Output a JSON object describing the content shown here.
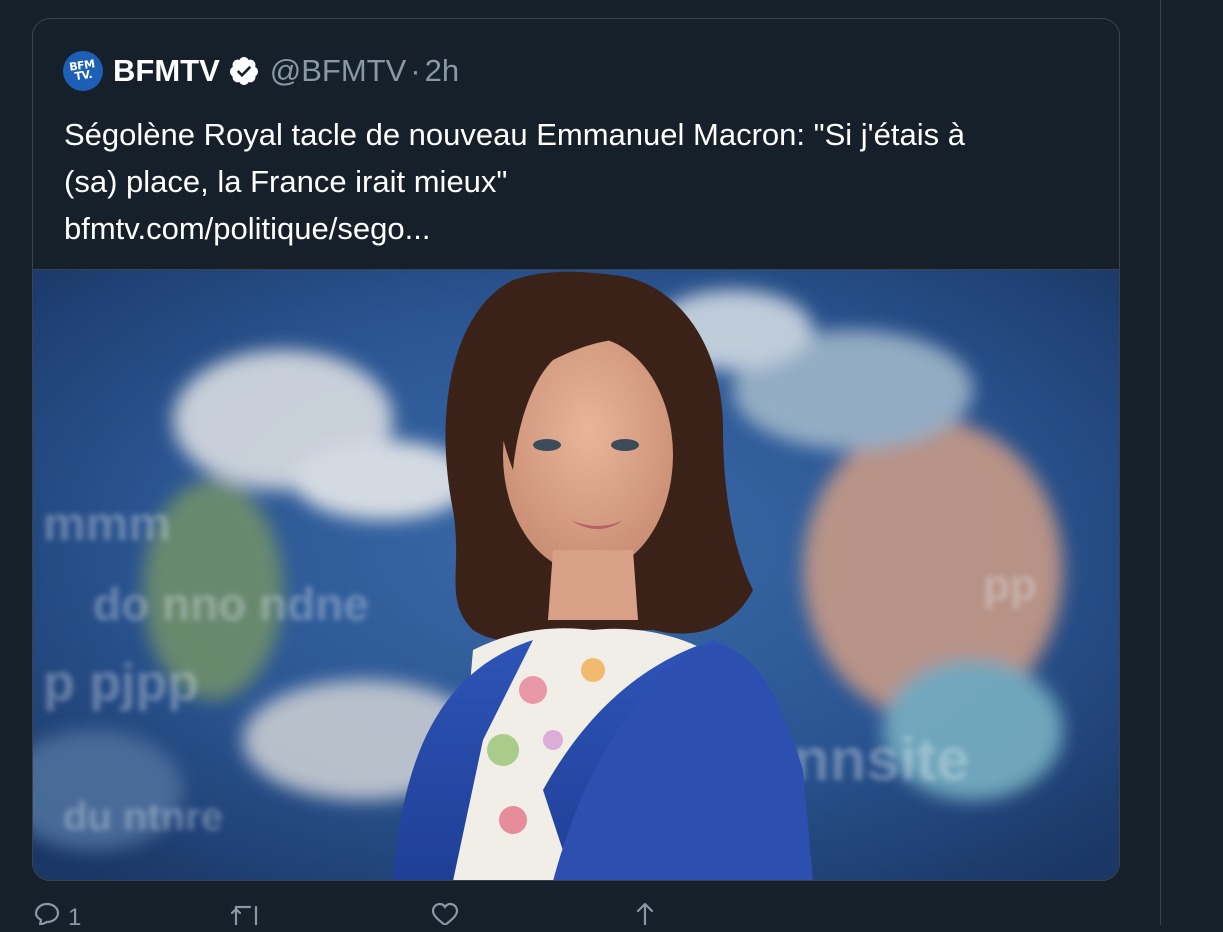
{
  "tweet": {
    "author": {
      "avatar_text_line1": "BFM",
      "avatar_text_line2": "TV.",
      "display_name": "BFMTV",
      "handle": "@BFMTV",
      "separator": "·",
      "time": "2h",
      "verified_icon": "verified-badge-icon"
    },
    "text_lines": [
      "Ségolène Royal tacle de nouveau Emmanuel Macron: \"Si j'étais à",
      "(sa) place, la France irait mieux\"",
      "bfmtv.com/politique/sego..."
    ],
    "actions": {
      "reply_count": "1",
      "reply_icon": "reply-icon",
      "retweet_icon": "retweet-icon",
      "like_icon": "heart-icon",
      "share_icon": "share-icon"
    }
  },
  "colors": {
    "background": "#15202b",
    "border": "#38444d",
    "text_primary": "#ffffff",
    "text_secondary": "#8899a6",
    "avatar_blue": "#1d5fb4"
  }
}
